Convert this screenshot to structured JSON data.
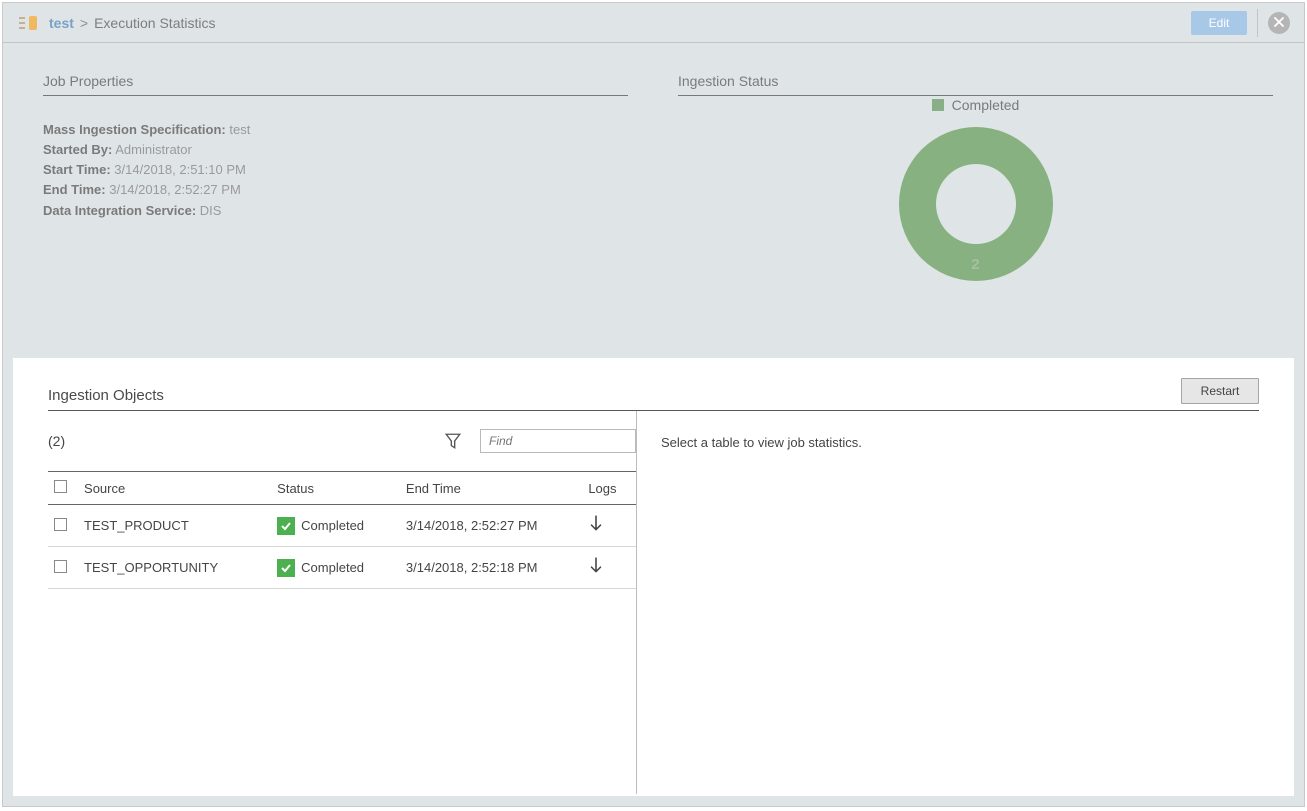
{
  "breadcrumb": {
    "link": "test",
    "separator": ">",
    "title": "Execution Statistics"
  },
  "header": {
    "edit_label": "Edit"
  },
  "sections": {
    "job_properties_title": "Job Properties",
    "ingestion_status_title": "Ingestion Status"
  },
  "props": {
    "spec_label": "Mass Ingestion Specification:",
    "spec_value": "test",
    "startedby_label": "Started By:",
    "startedby_value": "Administrator",
    "starttime_label": "Start Time:",
    "starttime_value": "3/14/2018, 2:51:10 PM",
    "endtime_label": "End Time:",
    "endtime_value": "3/14/2018, 2:52:27 PM",
    "dis_label": "Data Integration Service:",
    "dis_value": "DIS"
  },
  "chart_data": {
    "type": "pie",
    "legend": [
      {
        "label": "Completed",
        "color": "#88b181"
      }
    ],
    "series": [
      {
        "name": "Completed",
        "value": 2
      }
    ],
    "total_label": "2"
  },
  "objects": {
    "title": "Ingestion Objects",
    "restart_label": "Restart",
    "count_label": "(2)",
    "find_placeholder": "Find",
    "headers": {
      "source": "Source",
      "status": "Status",
      "endtime": "End Time",
      "logs": "Logs"
    },
    "rows": [
      {
        "source": "TEST_PRODUCT",
        "status": "Completed",
        "endtime": "3/14/2018, 2:52:27 PM"
      },
      {
        "source": "TEST_OPPORTUNITY",
        "status": "Completed",
        "endtime": "3/14/2018, 2:52:18 PM"
      }
    ]
  },
  "detail": {
    "placeholder": "Select a table to view job statistics."
  }
}
